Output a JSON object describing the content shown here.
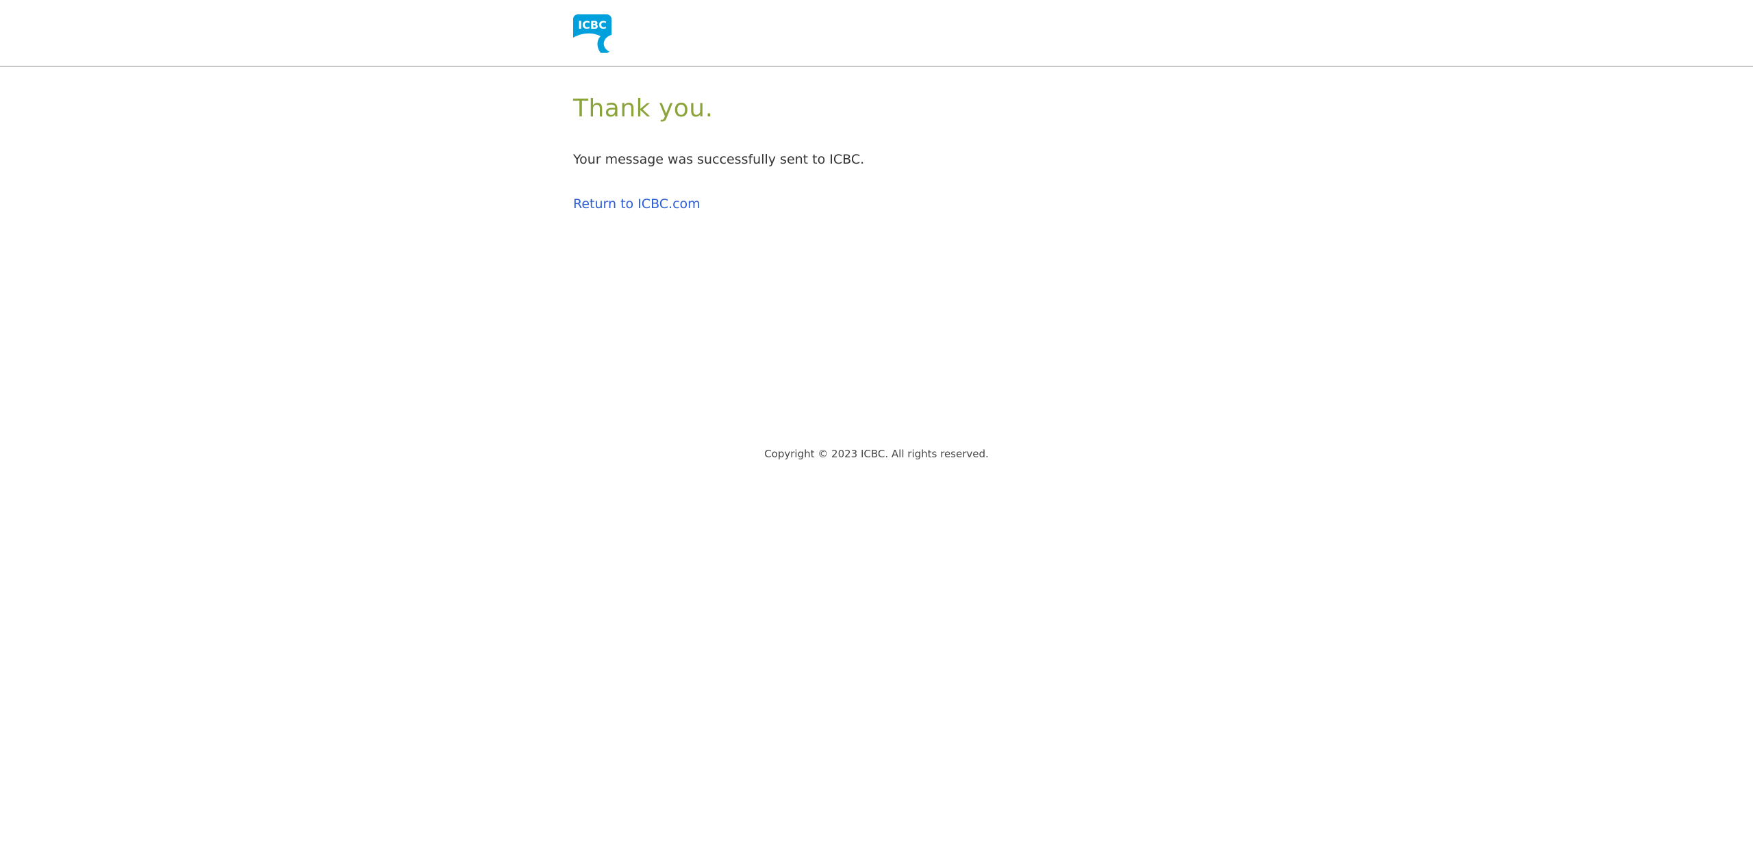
{
  "header": {
    "logo_text": "ICBC",
    "brand_color": "#00a0dc"
  },
  "main": {
    "title": "Thank you.",
    "message": "Your message was successfully sent to ICBC.",
    "return_link_label": "Return to ICBC.com"
  },
  "footer": {
    "copyright": "Copyright © 2023 ICBC. All rights reserved."
  },
  "colors": {
    "title": "#8aa33a",
    "link": "#2a5dd3",
    "header_border": "#c8c8c8"
  }
}
